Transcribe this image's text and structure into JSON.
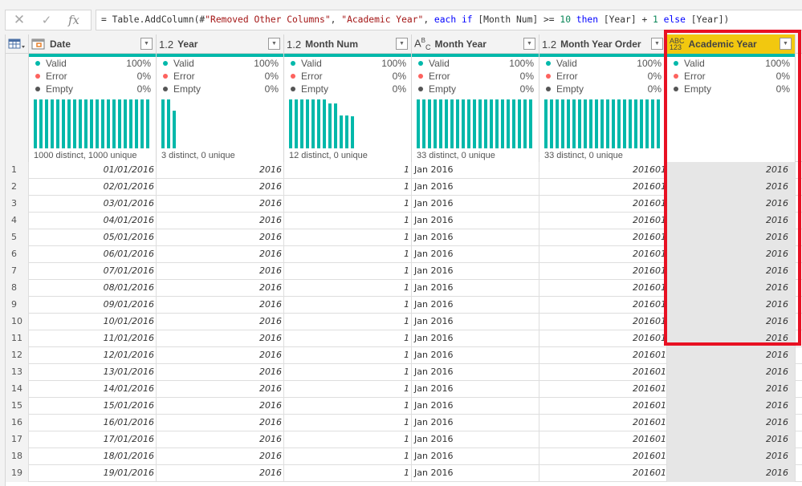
{
  "formula_bar": {
    "cancel_icon": "close-icon",
    "commit_icon": "check-icon",
    "fx_label": "fx",
    "tokens": [
      {
        "t": "= Table.AddColumn(#",
        "c": ""
      },
      {
        "t": "\"Removed Other Columns\"",
        "c": "str"
      },
      {
        "t": ", ",
        "c": ""
      },
      {
        "t": "\"Academic Year\"",
        "c": "str"
      },
      {
        "t": ", ",
        "c": ""
      },
      {
        "t": "each",
        "c": "kw"
      },
      {
        "t": " ",
        "c": ""
      },
      {
        "t": "if",
        "c": "kw"
      },
      {
        "t": " [Month Num] >= ",
        "c": ""
      },
      {
        "t": "10",
        "c": "num"
      },
      {
        "t": " ",
        "c": ""
      },
      {
        "t": "then",
        "c": "kw"
      },
      {
        "t": " [Year] + ",
        "c": ""
      },
      {
        "t": "1",
        "c": "num"
      },
      {
        "t": " ",
        "c": ""
      },
      {
        "t": "else",
        "c": "kw"
      },
      {
        "t": " [Year])",
        "c": ""
      }
    ]
  },
  "colors": {
    "valid": "#01b8aa",
    "error": "#fd625e",
    "empty": "#555555",
    "selected_header": "#f2c80f",
    "highlight": "#e81123"
  },
  "columns": [
    {
      "name": "Date",
      "type_icon": "calendar-icon",
      "type_label": "",
      "align": "num",
      "quality": {
        "valid": "100%",
        "error": "0%",
        "empty": "0%"
      },
      "distinct": "1000 distinct, 1000 unique",
      "histogram": [
        1,
        1,
        1,
        1,
        1,
        1,
        1,
        1,
        1,
        1,
        1,
        1,
        1,
        1,
        1,
        1,
        1,
        1,
        1,
        1,
        1
      ]
    },
    {
      "name": "Year",
      "type_icon": "decimal-icon",
      "type_label": "1.2",
      "align": "num",
      "quality": {
        "valid": "100%",
        "error": "0%",
        "empty": "0%"
      },
      "distinct": "3 distinct, 0 unique",
      "histogram": [
        1,
        1,
        0.77
      ]
    },
    {
      "name": "Month Num",
      "type_icon": "decimal-icon",
      "type_label": "1.2",
      "align": "num",
      "quality": {
        "valid": "100%",
        "error": "0%",
        "empty": "0%"
      },
      "distinct": "12 distinct, 0 unique",
      "histogram": [
        1,
        1,
        1,
        1,
        1,
        1,
        1,
        0.92,
        0.92,
        0.67,
        0.67,
        0.66
      ]
    },
    {
      "name": "Month Year",
      "type_icon": "text-icon",
      "type_label": "ABC",
      "align": "txt",
      "quality": {
        "valid": "100%",
        "error": "0%",
        "empty": "0%"
      },
      "distinct": "33 distinct, 0 unique",
      "histogram": [
        1,
        1,
        1,
        1,
        1,
        1,
        1,
        1,
        1,
        1,
        1,
        1,
        1,
        1,
        1,
        1,
        1,
        1,
        1,
        1,
        1
      ]
    },
    {
      "name": "Month Year Order",
      "type_icon": "decimal-icon",
      "type_label": "1.2",
      "align": "num",
      "quality": {
        "valid": "100%",
        "error": "0%",
        "empty": "0%"
      },
      "distinct": "33 distinct, 0 unique",
      "histogram": [
        1,
        1,
        1,
        1,
        1,
        1,
        1,
        1,
        1,
        1,
        1,
        1,
        1,
        1,
        1,
        1,
        1,
        1,
        1,
        1,
        1
      ]
    },
    {
      "name": "Academic Year",
      "type_icon": "any-type-icon",
      "type_label": "ABC\n123",
      "align": "num",
      "selected": true,
      "quality": {
        "valid": "100%",
        "error": "0%",
        "empty": "0%"
      },
      "distinct": "",
      "histogram": []
    }
  ],
  "quality_labels": {
    "valid": "Valid",
    "error": "Error",
    "empty": "Empty"
  },
  "rows": [
    [
      "1",
      "01/01/2016",
      "2016",
      "1",
      "Jan 2016",
      "201601",
      "2016"
    ],
    [
      "2",
      "02/01/2016",
      "2016",
      "1",
      "Jan 2016",
      "201601",
      "2016"
    ],
    [
      "3",
      "03/01/2016",
      "2016",
      "1",
      "Jan 2016",
      "201601",
      "2016"
    ],
    [
      "4",
      "04/01/2016",
      "2016",
      "1",
      "Jan 2016",
      "201601",
      "2016"
    ],
    [
      "5",
      "05/01/2016",
      "2016",
      "1",
      "Jan 2016",
      "201601",
      "2016"
    ],
    [
      "6",
      "06/01/2016",
      "2016",
      "1",
      "Jan 2016",
      "201601",
      "2016"
    ],
    [
      "7",
      "07/01/2016",
      "2016",
      "1",
      "Jan 2016",
      "201601",
      "2016"
    ],
    [
      "8",
      "08/01/2016",
      "2016",
      "1",
      "Jan 2016",
      "201601",
      "2016"
    ],
    [
      "9",
      "09/01/2016",
      "2016",
      "1",
      "Jan 2016",
      "201601",
      "2016"
    ],
    [
      "10",
      "10/01/2016",
      "2016",
      "1",
      "Jan 2016",
      "201601",
      "2016"
    ],
    [
      "11",
      "11/01/2016",
      "2016",
      "1",
      "Jan 2016",
      "201601",
      "2016"
    ],
    [
      "12",
      "12/01/2016",
      "2016",
      "1",
      "Jan 2016",
      "201601",
      "2016"
    ],
    [
      "13",
      "13/01/2016",
      "2016",
      "1",
      "Jan 2016",
      "201601",
      "2016"
    ],
    [
      "14",
      "14/01/2016",
      "2016",
      "1",
      "Jan 2016",
      "201601",
      "2016"
    ],
    [
      "15",
      "15/01/2016",
      "2016",
      "1",
      "Jan 2016",
      "201601",
      "2016"
    ],
    [
      "16",
      "16/01/2016",
      "2016",
      "1",
      "Jan 2016",
      "201601",
      "2016"
    ],
    [
      "17",
      "17/01/2016",
      "2016",
      "1",
      "Jan 2016",
      "201601",
      "2016"
    ],
    [
      "18",
      "18/01/2016",
      "2016",
      "1",
      "Jan 2016",
      "201601",
      "2016"
    ],
    [
      "19",
      "19/01/2016",
      "2016",
      "1",
      "Jan 2016",
      "201601",
      "2016"
    ]
  ]
}
